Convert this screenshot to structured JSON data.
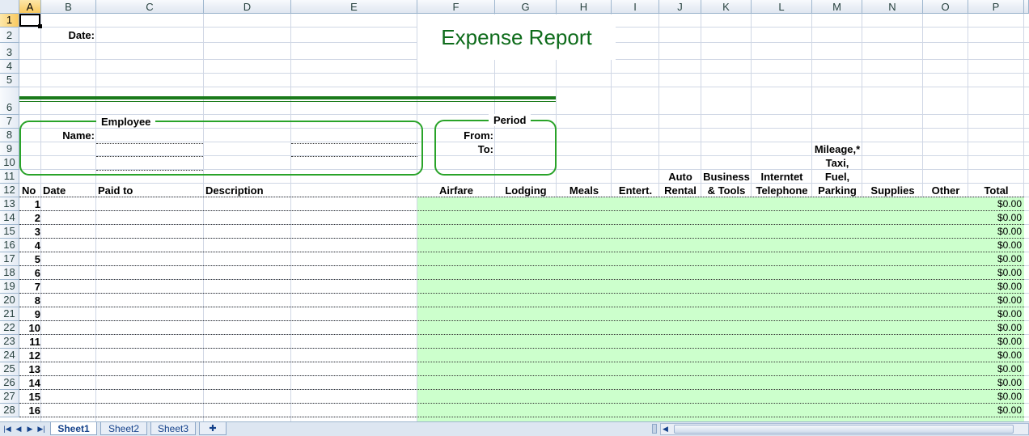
{
  "columns": [
    "A",
    "B",
    "C",
    "D",
    "E",
    "F",
    "G",
    "H",
    "I",
    "J",
    "K",
    "L",
    "M",
    "N",
    "O",
    "P"
  ],
  "rows": [
    "1",
    "2",
    "3",
    "4",
    "5",
    "6",
    "7",
    "8",
    "9",
    "10",
    "11",
    "12",
    "13",
    "14",
    "15",
    "16",
    "17",
    "18",
    "19",
    "20",
    "21",
    "22",
    "23",
    "24",
    "25",
    "26",
    "27",
    "28"
  ],
  "header": {
    "date_label": "Date:",
    "title": "Expense Report",
    "employee_label": "Employee",
    "name_label": "Name:",
    "period_label": "Period",
    "from_label": "From:",
    "to_label": "To:"
  },
  "table_headers": {
    "no": "No",
    "date": "Date",
    "paid_to": "Paid to",
    "description": "Description",
    "airfare": "Airfare",
    "lodging": "Lodging",
    "meals": "Meals",
    "entert": "Entert.",
    "auto_rental_1": "Auto",
    "auto_rental_2": "Rental",
    "business_tools_1": "Business",
    "business_tools_2": "& Tools",
    "internet_1": "Interntet",
    "internet_2": "Telephone",
    "mileage_1": "Mileage,*",
    "mileage_2": "Taxi,",
    "mileage_3": "Fuel,",
    "mileage_4": "Parking",
    "supplies": "Supplies",
    "other": "Other",
    "total": "Total"
  },
  "line_items": [
    {
      "no": "1",
      "total": "$0.00"
    },
    {
      "no": "2",
      "total": "$0.00"
    },
    {
      "no": "3",
      "total": "$0.00"
    },
    {
      "no": "4",
      "total": "$0.00"
    },
    {
      "no": "5",
      "total": "$0.00"
    },
    {
      "no": "6",
      "total": "$0.00"
    },
    {
      "no": "7",
      "total": "$0.00"
    },
    {
      "no": "8",
      "total": "$0.00"
    },
    {
      "no": "9",
      "total": "$0.00"
    },
    {
      "no": "10",
      "total": "$0.00"
    },
    {
      "no": "11",
      "total": "$0.00"
    },
    {
      "no": "12",
      "total": "$0.00"
    },
    {
      "no": "13",
      "total": "$0.00"
    },
    {
      "no": "14",
      "total": "$0.00"
    },
    {
      "no": "15",
      "total": "$0.00"
    },
    {
      "no": "16",
      "total": "$0.00"
    }
  ],
  "sheet_tabs": [
    "Sheet1",
    "Sheet2",
    "Sheet3"
  ],
  "active_tab": "Sheet1",
  "colors": {
    "title": "#0d6b1a",
    "rule": "#1a7a1a",
    "box_border": "#29a329",
    "expense_fill": "#ccffcc"
  }
}
